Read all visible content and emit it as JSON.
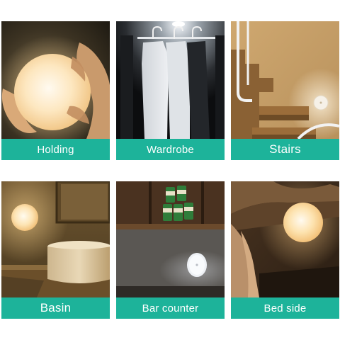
{
  "tiles": [
    {
      "label": "Holding"
    },
    {
      "label": "Wardrobe"
    },
    {
      "label": "Stairs"
    },
    {
      "label": "Basin"
    },
    {
      "label": "Bar counter"
    },
    {
      "label": "Bed side"
    }
  ],
  "colors": {
    "caption_bg": "#1db39a",
    "caption_text": "#ffffff",
    "warm_light": "#ffe9b8",
    "cool_light": "#f4f7fb"
  }
}
